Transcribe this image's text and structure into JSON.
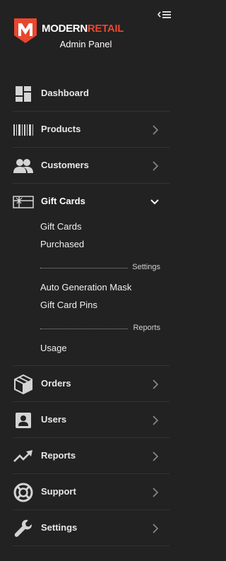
{
  "header": {
    "brand_part1": "MODERN",
    "brand_part2": "RETAIL",
    "subtitle": "Admin Panel",
    "brand_accent_color": "#e8472e"
  },
  "nav": {
    "items": [
      {
        "label": "Dashboard",
        "icon": "dashboard-icon"
      },
      {
        "label": "Products",
        "icon": "barcode-icon"
      },
      {
        "label": "Customers",
        "icon": "users-group-icon"
      },
      {
        "label": "Gift Cards",
        "icon": "gift-card-icon",
        "expanded": true
      },
      {
        "label": "Orders",
        "icon": "box-icon"
      },
      {
        "label": "Users",
        "icon": "user-badge-icon"
      },
      {
        "label": "Reports",
        "icon": "trend-icon"
      },
      {
        "label": "Support",
        "icon": "lifebuoy-icon"
      },
      {
        "label": "Settings",
        "icon": "wrench-icon"
      }
    ],
    "gift_cards_sub": {
      "items1": [
        "Gift Cards",
        "Purchased"
      ],
      "section_settings": "Settings",
      "items2": [
        "Auto Generation Mask",
        "Gift Card Pins"
      ],
      "section_reports": "Reports",
      "items3": [
        "Usage"
      ]
    }
  }
}
